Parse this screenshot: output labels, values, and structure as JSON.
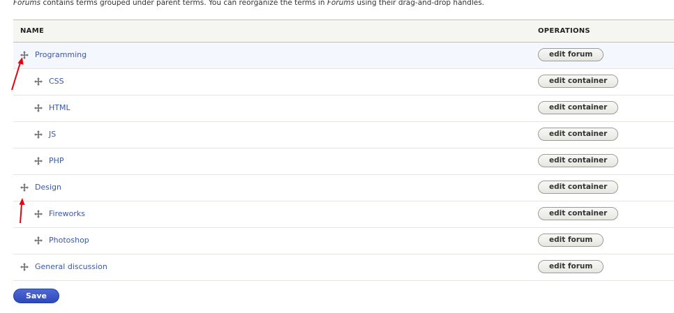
{
  "intro": {
    "part1": "Forums",
    "part2": " contains terms grouped under parent terms. You can reorganize the terms in ",
    "part3": "Forums",
    "part4": " using their drag-and-drop handles."
  },
  "table": {
    "headers": {
      "name": "NAME",
      "operations": "OPERATIONS"
    },
    "rows": [
      {
        "name": "Programming",
        "op": "edit forum",
        "depth": 0
      },
      {
        "name": "CSS",
        "op": "edit container",
        "depth": 1
      },
      {
        "name": "HTML",
        "op": "edit container",
        "depth": 1
      },
      {
        "name": "JS",
        "op": "edit container",
        "depth": 1
      },
      {
        "name": "PHP",
        "op": "edit container",
        "depth": 1
      },
      {
        "name": "Design",
        "op": "edit container",
        "depth": 0
      },
      {
        "name": "Fireworks",
        "op": "edit container",
        "depth": 1
      },
      {
        "name": "Photoshop",
        "op": "edit forum",
        "depth": 1
      },
      {
        "name": "General discussion",
        "op": "edit forum",
        "depth": 0
      }
    ]
  },
  "save_label": "Save",
  "icons": {
    "drag_handle": "drag-handle-icon",
    "annotation": "red-arrow-icon"
  },
  "colors": {
    "link": "#3b58a6",
    "save": "#3b55c5",
    "annotation": "#e8000b"
  }
}
